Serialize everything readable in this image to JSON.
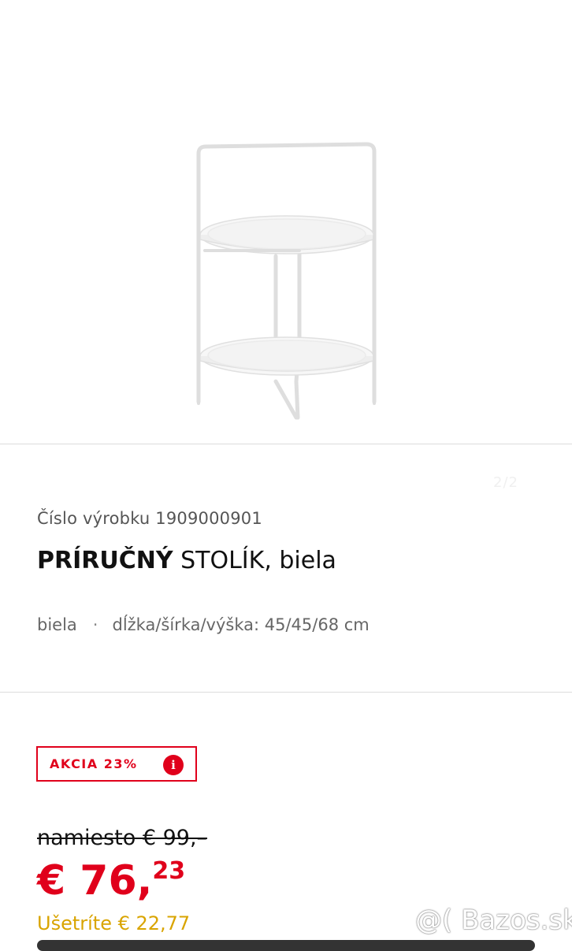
{
  "gallery": {
    "image": "white two-tier round side table with handle",
    "counter": "2/2"
  },
  "product": {
    "article_number": "Číslo výrobku 1909000901",
    "name_bold": "PRÍRUČNÝ",
    "name_rest": " STOLÍK, biela",
    "color": "biela",
    "dimensions": "dĺžka/šírka/výška: 45/45/68 cm"
  },
  "promo": {
    "badge": "AKCIA 23%",
    "info_icon": "i"
  },
  "pricing": {
    "old_price": "namiesto € 99,–",
    "price_main": "€ 76,",
    "price_cents": "23",
    "savings": "Ušetríte € 22,77"
  },
  "watermark": "@( Bazos.sk",
  "colors": {
    "accent": "#e0001b",
    "savings": "#d9a400"
  }
}
